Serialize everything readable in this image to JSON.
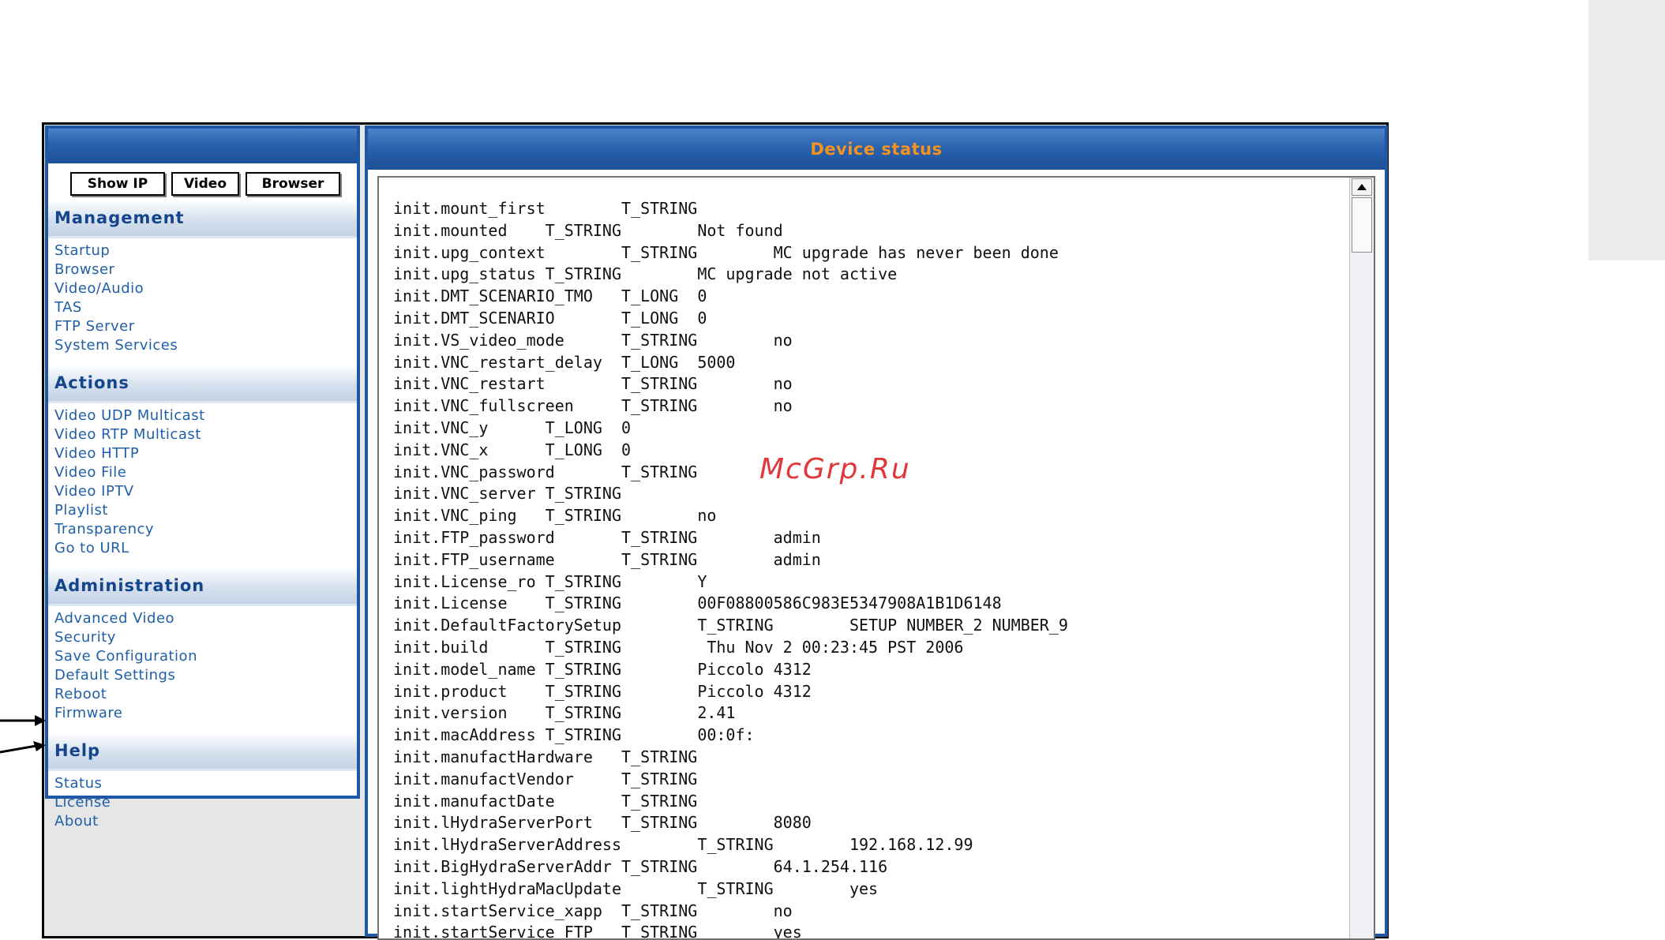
{
  "buttons": {
    "show_ip": "Show IP",
    "video": "Video",
    "browser": "Browser"
  },
  "sections": [
    {
      "title": "Management",
      "items": [
        "Startup",
        "Browser",
        "Video/Audio",
        "TAS",
        "FTP Server",
        "System Services"
      ]
    },
    {
      "title": "Actions",
      "items": [
        "Video UDP Multicast",
        "Video RTP Multicast",
        "Video HTTP",
        "Video File",
        "Video IPTV",
        "Playlist",
        "Transparency",
        "Go to URL"
      ]
    },
    {
      "title": "Administration",
      "items": [
        "Advanced Video",
        "Security",
        "Save Configuration",
        "Default Settings",
        "Reboot",
        "Firmware"
      ]
    },
    {
      "title": "Help",
      "items": [
        "Status",
        "License",
        "About"
      ]
    }
  ],
  "device_status": {
    "title": "Device status",
    "lines": [
      "init.mount_first        T_STRING",
      "init.mounted    T_STRING        Not found",
      "init.upg_context        T_STRING        MC upgrade has never been done",
      "init.upg_status T_STRING        MC upgrade not active",
      "init.DMT_SCENARIO_TMO   T_LONG  0",
      "init.DMT_SCENARIO       T_LONG  0",
      "init.VS_video_mode      T_STRING        no",
      "init.VNC_restart_delay  T_LONG  5000",
      "init.VNC_restart        T_STRING        no",
      "init.VNC_fullscreen     T_STRING        no",
      "init.VNC_y      T_LONG  0",
      "init.VNC_x      T_LONG  0",
      "init.VNC_password       T_STRING",
      "init.VNC_server T_STRING",
      "init.VNC_ping   T_STRING        no",
      "init.FTP_password       T_STRING        admin",
      "init.FTP_username       T_STRING        admin",
      "init.License_ro T_STRING        Y",
      "init.License    T_STRING        00F08800586C983E5347908A1B1D6148",
      "init.DefaultFactorySetup        T_STRING        SETUP NUMBER_2 NUMBER_9",
      "init.build      T_STRING         Thu Nov 2 00:23:45 PST 2006",
      "init.model_name T_STRING        Piccolo 4312",
      "init.product    T_STRING        Piccolo 4312",
      "init.version    T_STRING        2.41",
      "init.macAddress T_STRING        00:0f:",
      "init.manufactHardware   T_STRING",
      "init.manufactVendor     T_STRING",
      "init.manufactDate       T_STRING",
      "init.lHydraServerPort   T_STRING        8080",
      "init.lHydraServerAddress        T_STRING        192.168.12.99",
      "init.BigHydraServerAddr T_STRING        64.1.254.116",
      "init.lightHydraMacUpdate        T_STRING        yes",
      "init.startService_xapp  T_STRING        no",
      "init.startService_FTP   T_STRING        yes"
    ]
  },
  "watermark": "McGrp.Ru"
}
